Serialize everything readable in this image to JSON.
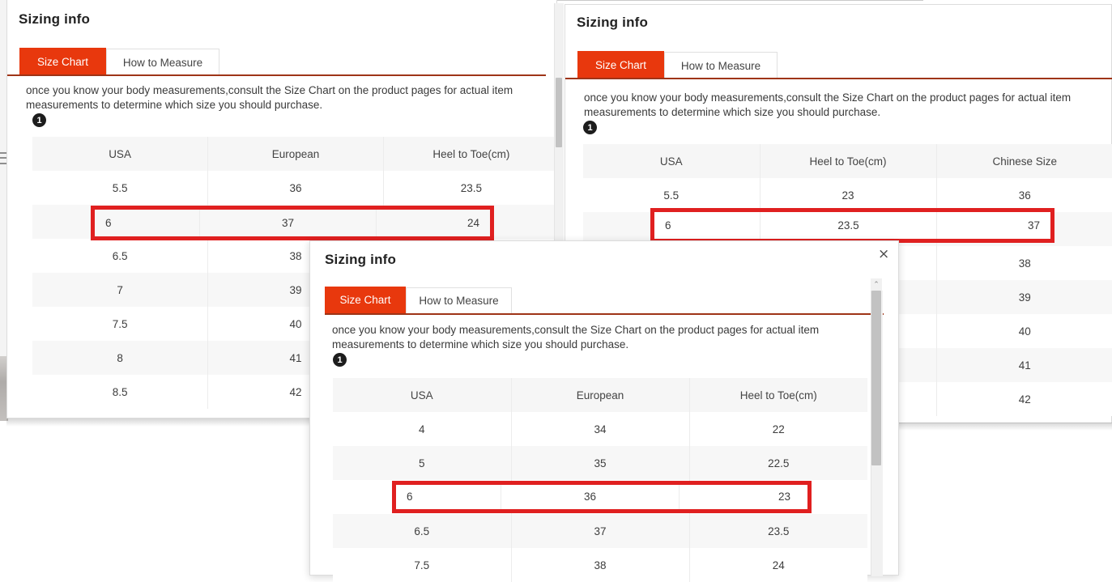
{
  "common": {
    "title": "Sizing info",
    "tab_size_chart": "Size Chart",
    "tab_how_to_measure": "How to Measure",
    "description": "once you know your body measurements,consult the Size Chart on the product pages for actual item measurements to determine which size you should purchase.",
    "step_number": "1",
    "close_label": "×",
    "accent_color": "#e8380d",
    "highlight_color": "#e02020",
    "tab_underline_color": "#9e3417"
  },
  "dialog_left": {
    "title": "Sizing info",
    "active_tab": "Size Chart",
    "columns": [
      "USA",
      "European",
      "Heel to Toe(cm)"
    ],
    "rows": [
      [
        "5.5",
        "36",
        "23.5"
      ],
      [
        "6",
        "37",
        "24"
      ],
      [
        "6.5",
        "38",
        ""
      ],
      [
        "7",
        "39",
        ""
      ],
      [
        "7.5",
        "40",
        ""
      ],
      [
        "8",
        "41",
        ""
      ],
      [
        "8.5",
        "42",
        ""
      ]
    ],
    "highlighted_row_index": 1,
    "highlighted_row": [
      "6",
      "37",
      "24"
    ]
  },
  "dialog_right": {
    "title": "Sizing info",
    "active_tab": "Size Chart",
    "columns": [
      "USA",
      "Heel to Toe(cm)",
      "Chinese Size"
    ],
    "rows": [
      [
        "5.5",
        "23",
        "36"
      ],
      [
        "6",
        "23.5",
        "37"
      ],
      [
        "",
        "",
        "38"
      ],
      [
        "",
        "",
        "39"
      ],
      [
        "",
        "",
        "40"
      ],
      [
        "",
        "",
        "41"
      ],
      [
        "",
        "",
        "42"
      ]
    ],
    "highlighted_row_index": 1,
    "highlighted_row": [
      "6",
      "23.5",
      "37"
    ]
  },
  "dialog_front": {
    "title": "Sizing info",
    "active_tab": "Size Chart",
    "columns": [
      "USA",
      "European",
      "Heel to Toe(cm)"
    ],
    "rows": [
      [
        "4",
        "34",
        "22"
      ],
      [
        "5",
        "35",
        "22.5"
      ],
      [
        "6",
        "36",
        "23"
      ],
      [
        "6.5",
        "37",
        "23.5"
      ],
      [
        "7.5",
        "38",
        "24"
      ]
    ],
    "highlighted_row_index": 2,
    "highlighted_row": [
      "6",
      "36",
      "23"
    ],
    "scrollbar": {
      "up_arrow": "⌃"
    }
  }
}
